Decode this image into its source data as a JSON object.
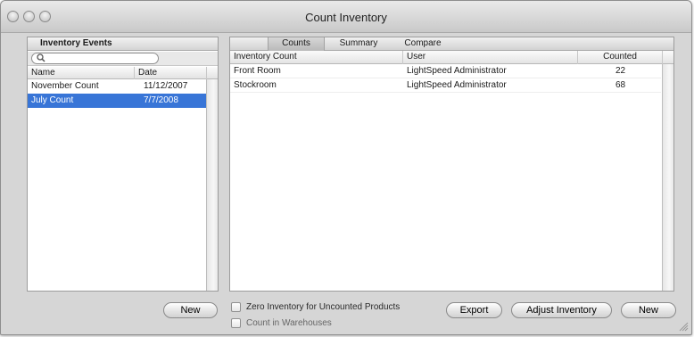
{
  "window": {
    "title": "Count Inventory"
  },
  "left_panel": {
    "header": "Inventory Events",
    "search": {
      "value": "",
      "placeholder": ""
    },
    "columns": [
      "Name",
      "Date"
    ],
    "rows": [
      {
        "name": "November Count",
        "date": "11/12/2007",
        "selected": false
      },
      {
        "name": "July Count",
        "date": "7/7/2008",
        "selected": true
      }
    ],
    "new_button": "New"
  },
  "right_panel": {
    "tabs": [
      {
        "label": "Counts",
        "active": true
      },
      {
        "label": "Summary",
        "active": false
      },
      {
        "label": "Compare",
        "active": false
      }
    ],
    "columns": [
      "Inventory Count",
      "User",
      "Counted"
    ],
    "rows": [
      {
        "inventory_count": "Front Room",
        "user": "LightSpeed Administrator",
        "counted": "22"
      },
      {
        "inventory_count": "Stockroom",
        "user": "LightSpeed Administrator",
        "counted": "68"
      }
    ]
  },
  "options": {
    "zero_inventory": {
      "label": "Zero Inventory for Uncounted Products",
      "checked": false
    },
    "count_in_warehouses": {
      "label": "Count in Warehouses",
      "checked": false
    }
  },
  "buttons": {
    "export": "Export",
    "adjust_inventory": "Adjust Inventory",
    "new": "New"
  },
  "colors": {
    "selection": "#3875d7",
    "window_bg": "#d6d6d6"
  },
  "icons": [
    "search-icon",
    "resize-grip-icon"
  ]
}
